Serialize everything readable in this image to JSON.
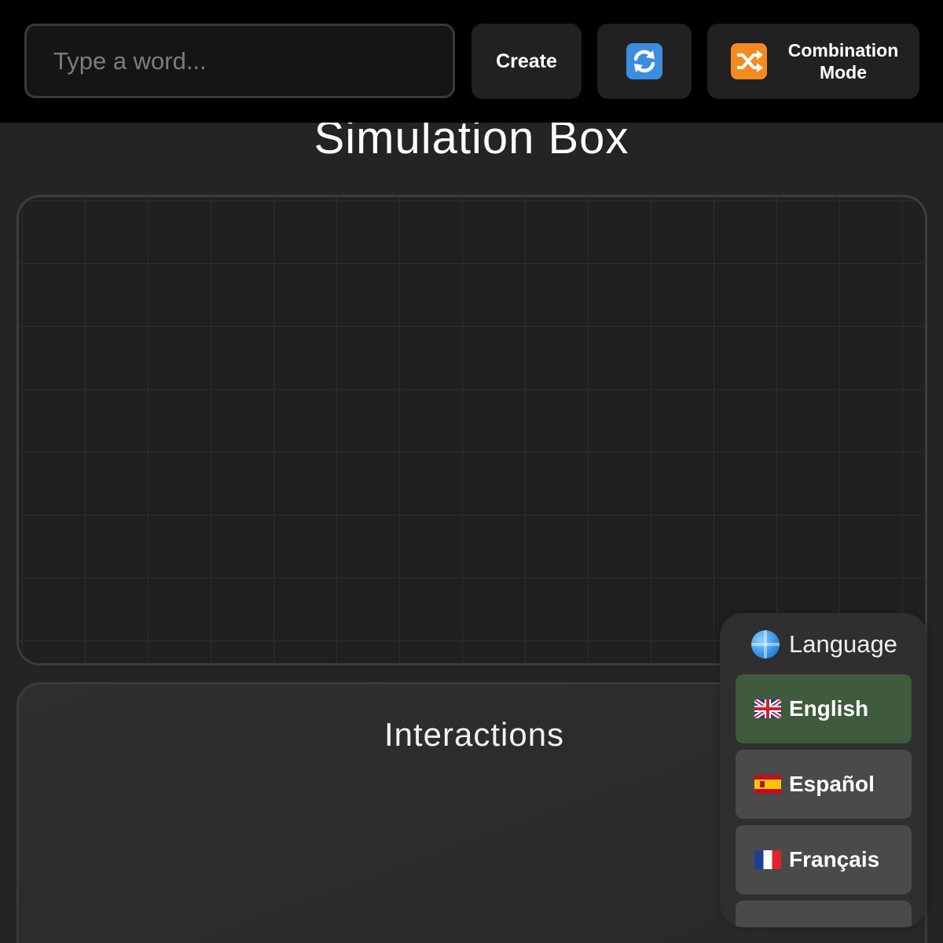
{
  "toolbar": {
    "word_input": {
      "placeholder": "Type a word...",
      "value": ""
    },
    "create_label": "Create",
    "swap_icon": "counterclockwise-arrows-icon",
    "combination_mode": {
      "icon": "shuffle-icon",
      "label": "Combination Mode"
    }
  },
  "simulation": {
    "title": "Simulation Box"
  },
  "interactions": {
    "title": "Interactions"
  },
  "language_menu": {
    "icon": "globe-icon",
    "header": "Language",
    "options": [
      {
        "flag": "gb-flag-icon",
        "label": "English",
        "selected": true
      },
      {
        "flag": "es-flag-icon",
        "label": "Español",
        "selected": false
      },
      {
        "flag": "fr-flag-icon",
        "label": "Français",
        "selected": false
      },
      {
        "flag": "de-flag-icon",
        "label": "",
        "selected": false
      }
    ]
  },
  "colors": {
    "toolbar_bg": "#000000",
    "page_bg": "#242424",
    "button_bg": "#212121",
    "selected_option": "#3f5a3d",
    "option_bg": "#4a4a4a",
    "swap_icon_bg": "#3b8de0",
    "shuffle_icon_bg": "#f58a1f"
  }
}
